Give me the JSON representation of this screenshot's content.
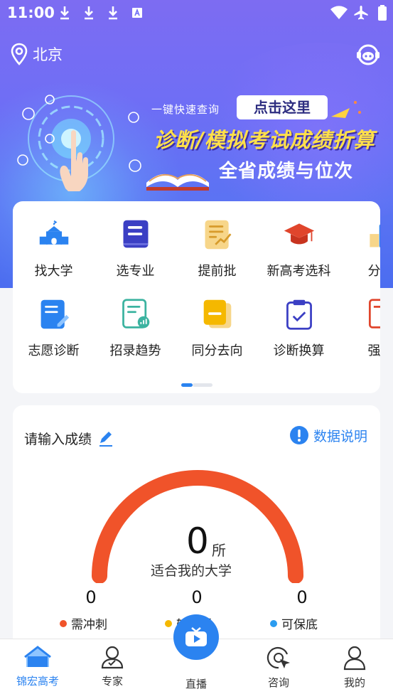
{
  "status_bar": {
    "time": "11:00"
  },
  "header": {
    "location": "北京"
  },
  "banner": {
    "quick_query": "一键快速查询",
    "click_here": "点击这里",
    "title": "诊断/模拟考试成绩折算",
    "subtitle": "全省成绩与位次"
  },
  "features": {
    "row1": [
      "找大学",
      "选专业",
      "提前批",
      "新高考选科",
      "分数"
    ],
    "row2": [
      "志愿诊断",
      "招录趋势",
      "同分去向",
      "诊断换算",
      "强基"
    ]
  },
  "score": {
    "prompt": "请输入成绩",
    "data_explain": "数据说明",
    "count": "0",
    "unit": "所",
    "caption": "适合我的大学",
    "categories": [
      {
        "label": "需冲刺",
        "count": "0",
        "color": "#f0532a"
      },
      {
        "label": "较稳妥",
        "count": "0",
        "color": "#f5b800"
      },
      {
        "label": "可保底",
        "count": "0",
        "color": "#2b9cf0"
      }
    ]
  },
  "nav": {
    "items": [
      "锦宏高考",
      "专家",
      "直播",
      "咨询",
      "我的"
    ],
    "active": "锦宏高考"
  },
  "colors": {
    "accent": "#2b83f0",
    "gauge": "#f0532a"
  }
}
